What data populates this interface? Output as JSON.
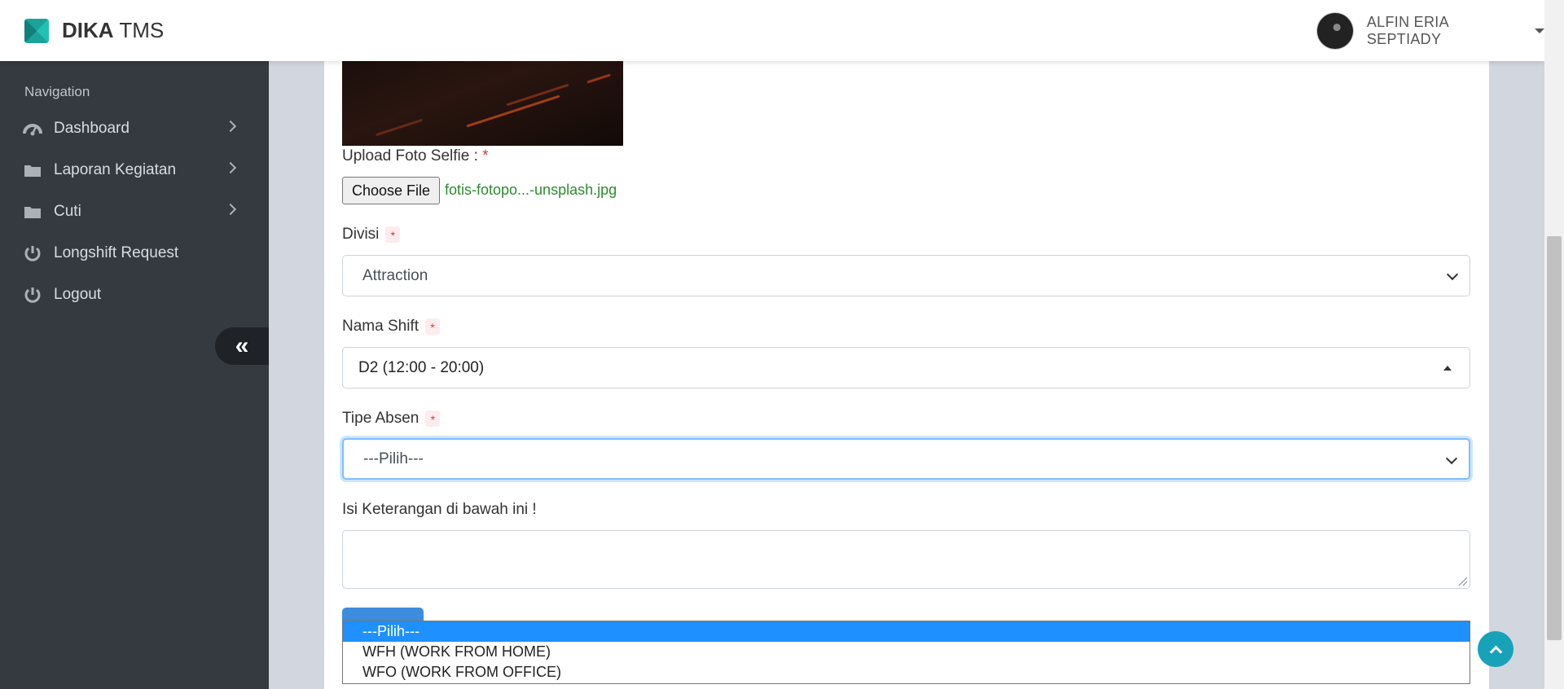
{
  "header": {
    "brand_bold": "DIKA",
    "brand_light": "TMS",
    "user_name": "ALFIN ERIA SEPTIADY"
  },
  "sidebar": {
    "nav_header": "Navigation",
    "items": [
      {
        "label": "Dashboard",
        "icon": "tachometer-icon",
        "has_submenu": true
      },
      {
        "label": "Laporan Kegiatan",
        "icon": "folder-icon",
        "has_submenu": true
      },
      {
        "label": "Cuti",
        "icon": "folder-icon",
        "has_submenu": true
      },
      {
        "label": "Longshift Request",
        "icon": "power-icon",
        "has_submenu": false
      },
      {
        "label": "Logout",
        "icon": "power-icon",
        "has_submenu": false
      }
    ],
    "collapse_icon": "«"
  },
  "form": {
    "upload_label": "Upload Foto Selfie :",
    "required_mark": "*",
    "file_button": "Choose File",
    "file_name": "fotis-fotopo...-unsplash.jpg",
    "divisi": {
      "label": "Divisi",
      "value": "Attraction"
    },
    "nama_shift": {
      "label": "Nama Shift",
      "value": "D2 (12:00 - 20:00)"
    },
    "tipe_absen": {
      "label": "Tipe Absen",
      "value": "---Pilih---",
      "options": [
        "---Pilih---",
        "WFH (WORK FROM HOME)",
        "WFO (WORK FROM OFFICE)"
      ]
    },
    "keterangan_label": "Isi Keterangan di bawah ini !"
  },
  "colors": {
    "sidebar_bg": "#343a40",
    "accent_teal": "#17a2b8",
    "option_highlight": "#1e90ff",
    "required_red": "#dc3545",
    "file_name_green": "#2e8b2e"
  }
}
